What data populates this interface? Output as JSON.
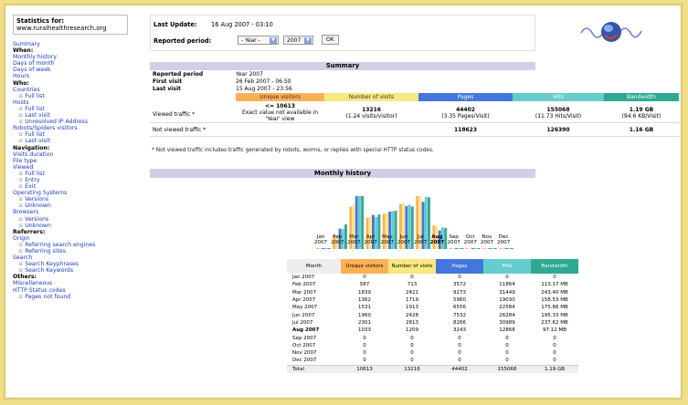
{
  "sidebar": {
    "stats_for_label": "Statistics for:",
    "site": "www.ruralhealthresearch.org",
    "items": [
      {
        "text": "Summary",
        "kind": "link"
      },
      {
        "text": "When:",
        "kind": "hdr"
      },
      {
        "text": "Monthly history",
        "kind": "link"
      },
      {
        "text": "Days of month",
        "kind": "link"
      },
      {
        "text": "Days of week",
        "kind": "link"
      },
      {
        "text": "Hours",
        "kind": "link"
      },
      {
        "text": "Who:",
        "kind": "hdr"
      },
      {
        "text": "Countries",
        "kind": "link"
      },
      {
        "text": "Full list",
        "kind": "sub"
      },
      {
        "text": "Hosts",
        "kind": "link"
      },
      {
        "text": "Full list",
        "kind": "sub"
      },
      {
        "text": "Last visit",
        "kind": "sub"
      },
      {
        "text": "Unresolved IP Address",
        "kind": "sub"
      },
      {
        "text": "Robots/Spiders visitors",
        "kind": "link"
      },
      {
        "text": "Full list",
        "kind": "sub"
      },
      {
        "text": "Last visit",
        "kind": "sub"
      },
      {
        "text": "Navigation:",
        "kind": "hdr"
      },
      {
        "text": "Visits duration",
        "kind": "link"
      },
      {
        "text": "File type",
        "kind": "link"
      },
      {
        "text": "Viewed",
        "kind": "link"
      },
      {
        "text": "Full list",
        "kind": "sub"
      },
      {
        "text": "Entry",
        "kind": "sub"
      },
      {
        "text": "Exit",
        "kind": "sub"
      },
      {
        "text": "Operating Systems",
        "kind": "link"
      },
      {
        "text": "Versions",
        "kind": "sub"
      },
      {
        "text": "Unknown",
        "kind": "sub"
      },
      {
        "text": "Browsers",
        "kind": "link"
      },
      {
        "text": "Versions",
        "kind": "sub"
      },
      {
        "text": "Unknown",
        "kind": "sub"
      },
      {
        "text": "Referrers:",
        "kind": "hdr"
      },
      {
        "text": "Origin",
        "kind": "link"
      },
      {
        "text": "Referring search engines",
        "kind": "sub"
      },
      {
        "text": "Referring sites",
        "kind": "sub"
      },
      {
        "text": "Search",
        "kind": "link"
      },
      {
        "text": "Search Keyphrases",
        "kind": "sub"
      },
      {
        "text": "Search Keywords",
        "kind": "sub"
      },
      {
        "text": "Others:",
        "kind": "hdr"
      },
      {
        "text": "Miscellaneous",
        "kind": "link"
      },
      {
        "text": "HTTP Status codes",
        "kind": "link"
      },
      {
        "text": "Pages not found",
        "kind": "sub"
      }
    ]
  },
  "header": {
    "last_update_label": "Last Update:",
    "last_update_value": "16 Aug 2007 - 03:10",
    "reported_period_label": "Reported period:",
    "period_select": "- Year -",
    "year_select": "2007",
    "ok_label": "OK"
  },
  "summary": {
    "title": "Summary",
    "reported_period_label": "Reported period",
    "reported_period_value": "Year 2007",
    "first_visit_label": "First visit",
    "first_visit_value": "26 Feb 2007 - 06:50",
    "last_visit_label": "Last visit",
    "last_visit_value": "15 Aug 2007 - 23:56",
    "col_unique": "Unique visitors",
    "col_visits": "Number of visits",
    "col_pages": "Pages",
    "col_hits": "Hits",
    "col_bandwidth": "Bandwidth",
    "viewed_label": "Viewed traffic *",
    "viewed_unique": "<= 10613",
    "viewed_unique_note": "Exact value not available in 'Year' view",
    "viewed_visits": "13216",
    "viewed_visits_sub": "(1.24 visits/visitor)",
    "viewed_pages": "44402",
    "viewed_pages_sub": "(3.35 Pages/Visit)",
    "viewed_hits": "155068",
    "viewed_hits_sub": "(11.73 Hits/Visit)",
    "viewed_bw": "1.19 GB",
    "viewed_bw_sub": "(94.6 KB/Visit)",
    "notviewed_label": "Not viewed traffic *",
    "notviewed_pages": "118623",
    "notviewed_hits": "126390",
    "notviewed_bw": "1.16 GB",
    "footnote": "* Not viewed traffic includes traffic generated by robots, worms, or replies with special HTTP status codes."
  },
  "monthly": {
    "title": "Monthly history",
    "headers": {
      "month": "Month",
      "unique": "Unique visitors",
      "visits": "Number of visits",
      "pages": "Pages",
      "hits": "Hits",
      "bandwidth": "Bandwidth"
    },
    "rows": [
      {
        "month": "Jan 2007",
        "unique": "0",
        "visits": "0",
        "pages": "0",
        "hits": "0",
        "bw": "0",
        "bold": false
      },
      {
        "month": "Feb 2007",
        "unique": "587",
        "visits": "713",
        "pages": "3572",
        "hits": "11864",
        "bw": "113.17 MB",
        "bold": false
      },
      {
        "month": "Mar 2007",
        "unique": "1839",
        "visits": "2421",
        "pages": "9273",
        "hits": "31449",
        "bw": "243.40 MB",
        "bold": false
      },
      {
        "month": "Apr 2007",
        "unique": "1362",
        "visits": "1719",
        "pages": "5960",
        "hits": "19030",
        "bw": "158.53 MB",
        "bold": false
      },
      {
        "month": "May 2007",
        "unique": "1531",
        "visits": "1913",
        "pages": "6556",
        "hits": "22584",
        "bw": "175.86 MB",
        "bold": false
      },
      {
        "month": "Jun 2007",
        "unique": "1960",
        "visits": "2428",
        "pages": "7532",
        "hits": "26284",
        "bw": "195.33 MB",
        "bold": false
      },
      {
        "month": "Jul 2007",
        "unique": "2301",
        "visits": "2813",
        "pages": "8266",
        "hits": "30989",
        "bw": "237.62 MB",
        "bold": false
      },
      {
        "month": "Aug 2007",
        "unique": "1033",
        "visits": "1209",
        "pages": "3243",
        "hits": "12868",
        "bw": "97.12 MB",
        "bold": true
      },
      {
        "month": "Sep 2007",
        "unique": "0",
        "visits": "0",
        "pages": "0",
        "hits": "0",
        "bw": "0",
        "bold": false
      },
      {
        "month": "Oct 2007",
        "unique": "0",
        "visits": "0",
        "pages": "0",
        "hits": "0",
        "bw": "0",
        "bold": false
      },
      {
        "month": "Nov 2007",
        "unique": "0",
        "visits": "0",
        "pages": "0",
        "hits": "0",
        "bw": "0",
        "bold": false
      },
      {
        "month": "Dec 2007",
        "unique": "0",
        "visits": "0",
        "pages": "0",
        "hits": "0",
        "bw": "0",
        "bold": false
      }
    ],
    "total": {
      "label": "Total",
      "unique": "10613",
      "visits": "13216",
      "pages": "44402",
      "hits": "155068",
      "bw": "1.19 GB"
    }
  },
  "chart_data": {
    "type": "bar",
    "categories": [
      "Jan",
      "Feb",
      "Mar",
      "Apr",
      "May",
      "Jun",
      "Jul",
      "Aug",
      "Sep",
      "Oct",
      "Nov",
      "Dec"
    ],
    "category_year": "2007",
    "bold_category": "Aug",
    "series": [
      {
        "name": "Unique visitors",
        "color": "#ffb055",
        "values": [
          0,
          587,
          1839,
          1362,
          1531,
          1960,
          2301,
          1033,
          0,
          0,
          0,
          0
        ]
      },
      {
        "name": "Number of visits",
        "color": "#f8e880",
        "values": [
          0,
          713,
          2421,
          1719,
          1913,
          2428,
          2813,
          1209,
          0,
          0,
          0,
          0
        ]
      },
      {
        "name": "Pages",
        "color": "#4477dd",
        "values": [
          0,
          3572,
          9273,
          5960,
          6556,
          7532,
          8266,
          3243,
          0,
          0,
          0,
          0
        ]
      },
      {
        "name": "Hits",
        "color": "#66cccc",
        "values": [
          0,
          11864,
          31449,
          19030,
          22584,
          26284,
          30989,
          12868,
          0,
          0,
          0,
          0
        ]
      },
      {
        "name": "Bandwidth (MB)",
        "color": "#2eaa92",
        "values": [
          0,
          113.17,
          243.4,
          158.53,
          175.86,
          195.33,
          237.62,
          97.12,
          0,
          0,
          0,
          0
        ]
      }
    ]
  }
}
